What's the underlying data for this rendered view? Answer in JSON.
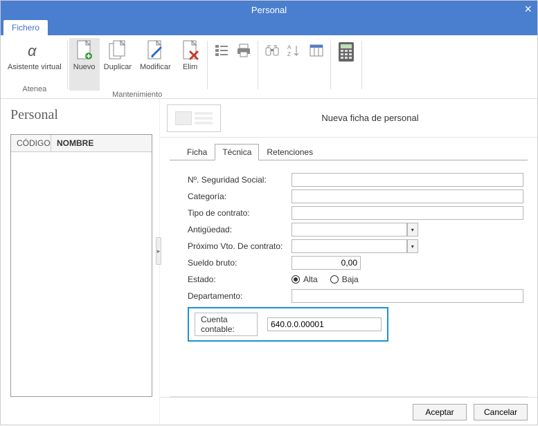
{
  "window": {
    "title": "Personal",
    "close_icon": "×"
  },
  "menu": {
    "tab_file": "Fichero"
  },
  "ribbon": {
    "assistant": {
      "label": "Asistente virtual",
      "sub": "Atenea"
    },
    "new": "Nuevo",
    "duplicate": "Duplicar",
    "modify": "Modificar",
    "delete": "Elim",
    "group_label": "Mantenimiento"
  },
  "left": {
    "heading": "Personal",
    "col_code": "CÓDIGO",
    "col_name": "NOMBRE"
  },
  "detail": {
    "title": "Nueva ficha de personal",
    "tabs": {
      "ficha": "Ficha",
      "tecnica": "Técnica",
      "retenciones": "Retenciones"
    },
    "fields": {
      "ssn": "Nº. Seguridad Social:",
      "categoria": "Categoría:",
      "tipo_contrato": "Tipo de contrato:",
      "antiguedad": "Antigüedad:",
      "proximo_vto": "Próximo Vto. De contrato:",
      "sueldo": "Sueldo bruto:",
      "sueldo_val": "0,00",
      "estado": "Estado:",
      "alta": "Alta",
      "baja": "Baja",
      "departamento": "Departamento:",
      "cuenta_lbl": "Cuenta contable:",
      "cuenta_val": "640.0.0.00001"
    }
  },
  "footer": {
    "accept": "Aceptar",
    "cancel": "Cancelar"
  }
}
